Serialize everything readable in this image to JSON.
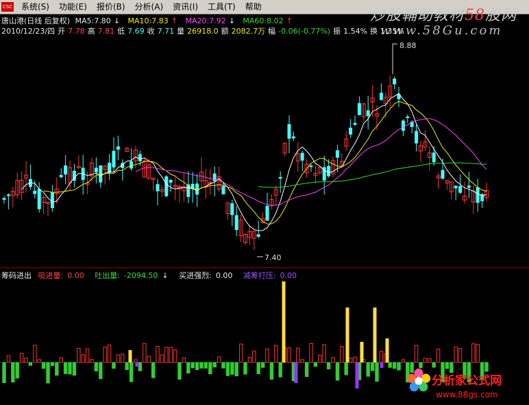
{
  "menu": {
    "logo": "CSC",
    "items": [
      "系统(S)",
      "功能(E)",
      "报价(B)",
      "分析(A)",
      "资讯(I)",
      "工具(T)",
      "帮助"
    ]
  },
  "watermark": {
    "title_a": "炒股輔助教材",
    "title_num": "58",
    "title_b": "股网",
    "url": "www.58Gu.com"
  },
  "header": {
    "stock": "唐山港(日线 后复权)",
    "ma5": "MA5:7.80",
    "ma10": "MA10:7.83",
    "ma20": "MA20:7.92",
    "ma60": "MA60:8.02",
    "arrow_down": "↓",
    "arrow_up": "↑",
    "date": "2010/12/23/四",
    "open_label": "开",
    "open": "7.78",
    "high_label": "高",
    "high": "7.81",
    "low_label": "低",
    "low": "7.69",
    "close_label": "收",
    "close": "7.71",
    "vol_label": "量",
    "vol": "26918.0",
    "amt_label": "额",
    "amt": "2082.7万",
    "chg_label": "幅",
    "chg": "-0.06(-0.77%)",
    "amp_label": "振",
    "amp": "1.54%",
    "turn_label": "换",
    "turn": "1.35%"
  },
  "price_labels": {
    "high_mark": "8.88",
    "low_mark": "7.40"
  },
  "indicator": {
    "name": "筹码进出",
    "inflow_label": "吸进量:",
    "inflow": "0.00",
    "outflow_label": "吐出量:",
    "outflow": "-2094.50",
    "outflow_arrow": "↓",
    "strong_label": "买进强烈:",
    "strong": "0.00",
    "pressure_label": "减筹打压:",
    "pressure": "0.00"
  },
  "brand": {
    "name": "分析家公式网",
    "url": "www.88gs.com"
  },
  "colors": {
    "up": "#ff3333",
    "down": "#44ffff",
    "ma5": "#ffffff",
    "ma10": "#f0f000",
    "ma20": "#ff44ff",
    "ma60": "#33dd33",
    "inflow": "#ff3333",
    "outflow": "#33cc33",
    "strong": "#ffdd44",
    "pressure": "#9933ff"
  }
}
